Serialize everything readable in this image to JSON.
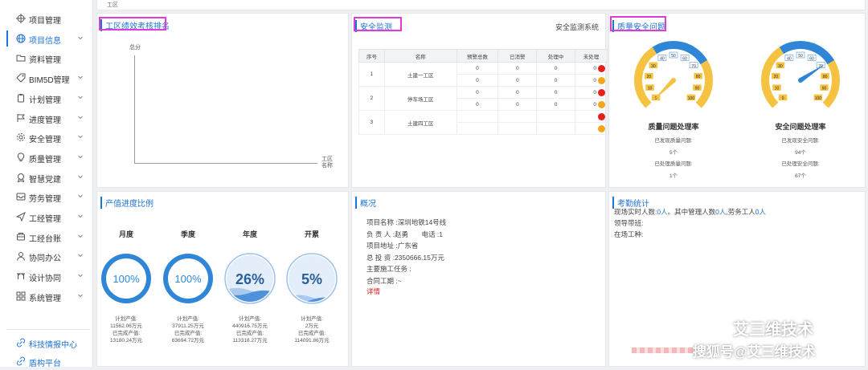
{
  "sidebar": {
    "items": [
      {
        "label": "项目管理",
        "icon": "crosshair-icon",
        "chevron": false,
        "active": false
      },
      {
        "label": "项目信息",
        "icon": "globe-icon",
        "chevron": true,
        "active": true
      },
      {
        "label": "资料管理",
        "icon": "folder-icon",
        "chevron": false,
        "active": false
      },
      {
        "label": "BIM5D管理",
        "icon": "tag-icon",
        "chevron": true,
        "active": false
      },
      {
        "label": "计划管理",
        "icon": "clipboard-icon",
        "chevron": true,
        "active": false
      },
      {
        "label": "进度管理",
        "icon": "flag-icon",
        "chevron": true,
        "active": false
      },
      {
        "label": "安全管理",
        "icon": "gear-icon",
        "chevron": true,
        "active": false
      },
      {
        "label": "质量管理",
        "icon": "bulb-icon",
        "chevron": true,
        "active": false
      },
      {
        "label": "智慧党建",
        "icon": "badge-icon",
        "chevron": true,
        "active": false
      },
      {
        "label": "劳务管理",
        "icon": "inbox-icon",
        "chevron": true,
        "active": false
      },
      {
        "label": "工经管理",
        "icon": "send-icon",
        "chevron": true,
        "active": false
      },
      {
        "label": "工经台账",
        "icon": "ledger-icon",
        "chevron": true,
        "active": false
      },
      {
        "label": "协同办公",
        "icon": "user-icon",
        "chevron": true,
        "active": false
      },
      {
        "label": "设计协同",
        "icon": "bridge-icon",
        "chevron": true,
        "active": false
      },
      {
        "label": "系统管理",
        "icon": "grid-icon",
        "chevron": true,
        "active": false
      }
    ],
    "bottom_items": [
      {
        "label": "科技情报中心",
        "icon": "link-icon"
      },
      {
        "label": "盾构平台",
        "icon": "link-icon"
      }
    ]
  },
  "top_strip": {
    "partial_label": "工区"
  },
  "performance": {
    "title": "工区绩效考核排名",
    "chart_data": {
      "type": "bar",
      "title": "工区绩效考核排名",
      "ylabel": "总分",
      "xlabel": "工区名称",
      "categories": [],
      "values": []
    }
  },
  "safety": {
    "title": "安全监测",
    "system_label": "安全监测系统",
    "headers": [
      "序号",
      "名称",
      "预警总数",
      "已消警",
      "处理中",
      "未处理"
    ],
    "rows": [
      {
        "no": "1",
        "name": "土建一工区",
        "sub": [
          {
            "total": "0",
            "cleared": "0",
            "processing": "0",
            "pending": "0",
            "dot": "#e5201c"
          },
          {
            "total": "0",
            "cleared": "0",
            "processing": "0",
            "pending": "0",
            "dot": "#f3a61c"
          }
        ]
      },
      {
        "no": "2",
        "name": "停车场工区",
        "sub": [
          {
            "total": "0",
            "cleared": "0",
            "processing": "0",
            "pending": "0",
            "dot": "#e5201c"
          },
          {
            "total": "0",
            "cleared": "0",
            "processing": "0",
            "pending": "0",
            "dot": "#f3a61c"
          }
        ]
      },
      {
        "no": "3",
        "name": "土建四工区",
        "sub": [
          {
            "total": "",
            "cleared": "",
            "processing": "",
            "pending": "",
            "dot": "#e5201c"
          },
          {
            "total": "",
            "cleared": "",
            "processing": "",
            "pending": "",
            "dot": "#f3a61c"
          }
        ]
      }
    ]
  },
  "quality": {
    "title": "质量安全问题",
    "gauge_colors": {
      "blue": "#2f86d6",
      "yellow": "#f5c242"
    },
    "gauges": [
      {
        "title": "质量问题处理率",
        "value": 0,
        "found_label": "已发现质量问题:",
        "found": "5个",
        "handled_label": "已处理质量问题:",
        "handled": "1个"
      },
      {
        "title": "安全问题处理率",
        "value": 71,
        "found_label": "已发现安全问题:",
        "found": "94个",
        "handled_label": "已处理安全问题:",
        "handled": "67个"
      }
    ],
    "ticks": [
      "0",
      "10",
      "20",
      "30",
      "40",
      "50",
      "60",
      "70",
      "80",
      "90",
      "100"
    ]
  },
  "output": {
    "title": "产值进度比例",
    "items": [
      {
        "period": "月度",
        "percent": "100%",
        "ratio": 1.0,
        "plan_label": "计划产值:",
        "plan": "11562.06万元",
        "done_label": "已完成产值:",
        "done": "13180.24万元"
      },
      {
        "period": "季度",
        "percent": "100%",
        "ratio": 1.0,
        "plan_label": "计划产值:",
        "plan": "37911.25万元",
        "done_label": "已完成产值:",
        "done": "63694.72万元"
      },
      {
        "period": "年度",
        "percent": "26%",
        "ratio": 0.26,
        "plan_label": "计划产值:",
        "plan": "440916.75万元",
        "done_label": "已完成产值:",
        "done": "113318.27万元"
      },
      {
        "period": "开累",
        "percent": "5%",
        "ratio": 0.05,
        "plan_label": "计划产值:",
        "plan": "2万元",
        "done_label": "已完成产值:",
        "done": "114091.86万元"
      }
    ]
  },
  "overview": {
    "title": "概况",
    "lines": [
      "项目名称 :深圳地铁14号线",
      "负 责 人 :赵勇       电话 :1",
      "项目地址 :广东省",
      "总 投 资 :2350666.15万元",
      "主要施工任务 :",
      "合同工期 :~"
    ],
    "detail_link": "详情"
  },
  "attendance": {
    "title": "考勤统计",
    "line1_label": "现场实时人数:",
    "line1_count": "0人",
    "line1_mid": "。其中管理人数",
    "line1_mgmt": "0人",
    "line1_sep": ",劳务工人",
    "line1_labor": "0人",
    "line2": "领导带班:",
    "line3": "在场工种:"
  },
  "watermark": {
    "brand": "艾三维技术",
    "footer": "搜狐号@艾三维技术"
  }
}
